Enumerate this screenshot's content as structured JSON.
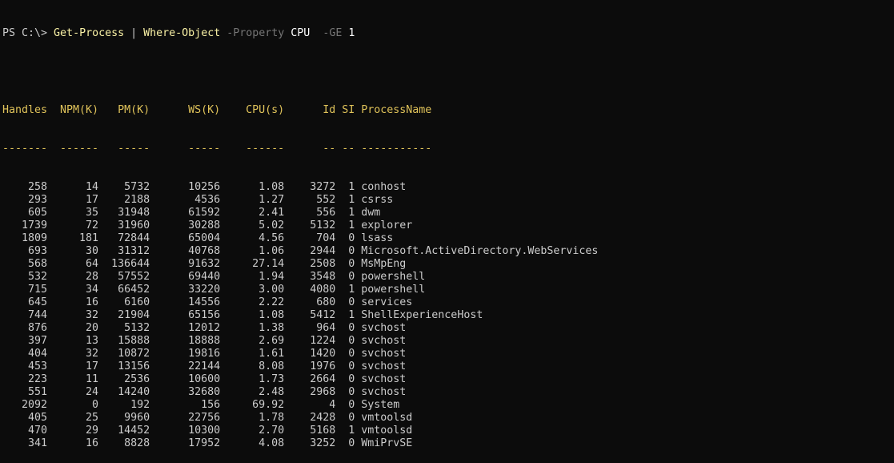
{
  "prompt": {
    "text": "PS C:\\> ",
    "cmdlet": "Get-Process",
    "pipe": " | ",
    "cmdlet2": "Where-Object",
    "param1": " -Property ",
    "arg1": "CPU",
    "param2": "  -GE ",
    "arg2": "1"
  },
  "colors": {
    "background": "#0c0c0c",
    "text": "#cccccc",
    "cmdlet": "#f9f1a5",
    "parameter": "#767676",
    "argument": "#ffffff",
    "header": "#e0c35a"
  },
  "table": {
    "headers": [
      "Handles",
      "NPM(K)",
      "PM(K)",
      "WS(K)",
      "CPU(s)",
      "Id",
      "SI",
      "ProcessName"
    ],
    "separators": [
      "-------",
      "------",
      "-----",
      "-----",
      "------",
      "--",
      "--",
      "-----------"
    ],
    "rows": [
      [
        "258",
        "14",
        "5732",
        "10256",
        "1.08",
        "3272",
        "1",
        "conhost"
      ],
      [
        "293",
        "17",
        "2188",
        "4536",
        "1.27",
        "552",
        "1",
        "csrss"
      ],
      [
        "605",
        "35",
        "31948",
        "61592",
        "2.41",
        "556",
        "1",
        "dwm"
      ],
      [
        "1739",
        "72",
        "31960",
        "30288",
        "5.02",
        "5132",
        "1",
        "explorer"
      ],
      [
        "1809",
        "181",
        "72844",
        "65004",
        "4.56",
        "704",
        "0",
        "lsass"
      ],
      [
        "693",
        "30",
        "31312",
        "40768",
        "1.06",
        "2944",
        "0",
        "Microsoft.ActiveDirectory.WebServices"
      ],
      [
        "568",
        "64",
        "136644",
        "91632",
        "27.14",
        "2508",
        "0",
        "MsMpEng"
      ],
      [
        "532",
        "28",
        "57552",
        "69440",
        "1.94",
        "3548",
        "0",
        "powershell"
      ],
      [
        "715",
        "34",
        "66452",
        "33220",
        "3.00",
        "4080",
        "1",
        "powershell"
      ],
      [
        "645",
        "16",
        "6160",
        "14556",
        "2.22",
        "680",
        "0",
        "services"
      ],
      [
        "744",
        "32",
        "21904",
        "65156",
        "1.08",
        "5412",
        "1",
        "ShellExperienceHost"
      ],
      [
        "876",
        "20",
        "5132",
        "12012",
        "1.38",
        "964",
        "0",
        "svchost"
      ],
      [
        "397",
        "13",
        "15888",
        "18888",
        "2.69",
        "1224",
        "0",
        "svchost"
      ],
      [
        "404",
        "32",
        "10872",
        "19816",
        "1.61",
        "1420",
        "0",
        "svchost"
      ],
      [
        "453",
        "17",
        "13156",
        "22144",
        "8.08",
        "1976",
        "0",
        "svchost"
      ],
      [
        "223",
        "11",
        "2536",
        "10600",
        "1.73",
        "2664",
        "0",
        "svchost"
      ],
      [
        "551",
        "24",
        "14240",
        "32680",
        "2.48",
        "2968",
        "0",
        "svchost"
      ],
      [
        "2092",
        "0",
        "192",
        "156",
        "69.92",
        "4",
        "0",
        "System"
      ],
      [
        "405",
        "25",
        "9960",
        "22756",
        "1.78",
        "2428",
        "0",
        "vmtoolsd"
      ],
      [
        "470",
        "29",
        "14452",
        "10300",
        "2.70",
        "5168",
        "1",
        "vmtoolsd"
      ],
      [
        "341",
        "16",
        "8828",
        "17952",
        "4.08",
        "3252",
        "0",
        "WmiPrvSE"
      ]
    ]
  }
}
